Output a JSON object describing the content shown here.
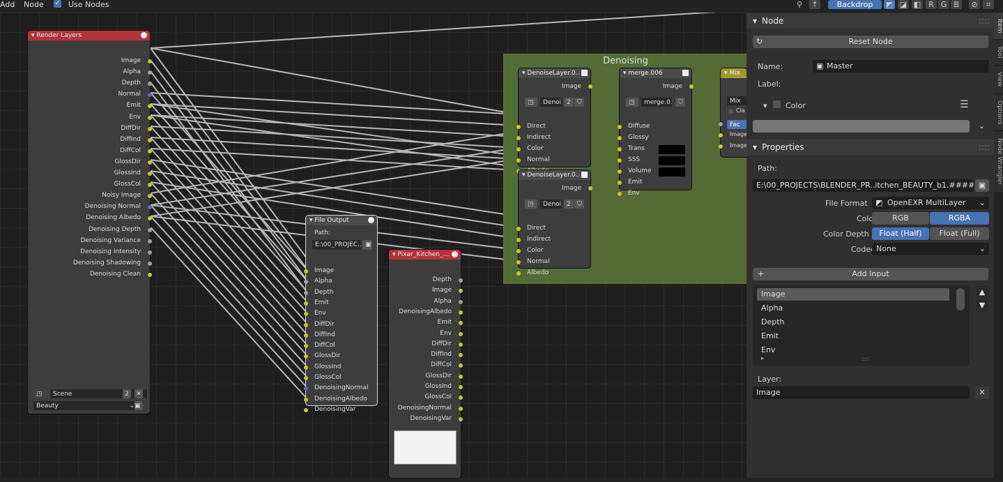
{
  "topbar": {
    "add": "Add",
    "node": "Node",
    "use_nodes": "Use Nodes",
    "backdrop": "Backdrop",
    "r": "R",
    "g": "G",
    "b": "B"
  },
  "render_layers": {
    "title": "Render Layers",
    "outputs": [
      "Image",
      "Alpha",
      "Depth",
      "Normal",
      "Emit",
      "Env",
      "DiffDir",
      "DiffInd",
      "DiffCol",
      "GlossDir",
      "GlossInd",
      "GlossCol",
      "Noisy Image",
      "Denoising Normal",
      "Denoising Albedo",
      "Denoising Depth",
      "Denoising Variance",
      "Denoising Intensity",
      "Denoising Shadowing",
      "Denoising Clean"
    ],
    "scene": "Scene",
    "scene_users": "2",
    "layer": "Beauty"
  },
  "file_output": {
    "title": "File Output",
    "path_label": "Path:",
    "path": "E:\\00_PROJEC...",
    "inputs": [
      "Image",
      "Alpha",
      "Depth",
      "Emit",
      "Env",
      "DiffDir",
      "DiffInd",
      "DiffCol",
      "GlossDir",
      "GlossInd",
      "GlossCol",
      "DenoisingNormal",
      "DenoisingAlbedo",
      "DenoisingVar"
    ]
  },
  "pixar_node": {
    "title": "Pixar_Kitchen_...",
    "outputs": [
      "Depth",
      "Image",
      "Alpha",
      "DenoisingAlbedo",
      "Emit",
      "Env",
      "DiffDir",
      "DiffInd",
      "DiffCol",
      "GlossDir",
      "GlossInd",
      "GlossCol",
      "DenoisingNormal",
      "DenoisingVar"
    ]
  },
  "frame": {
    "title": "Denoising"
  },
  "denoise1": {
    "title": "DenoiseLayer.0..",
    "output": "Image",
    "sel": "Denoi",
    "users": "2",
    "inputs": [
      "Direct",
      "Indirect",
      "Color",
      "Normal",
      "Albedo"
    ]
  },
  "denoise2": {
    "title": "DenoiseLayer.0..",
    "output": "Image",
    "sel": "Denoi",
    "users": "2",
    "inputs": [
      "Direct",
      "Indirect",
      "Color",
      "Normal",
      "Albedo"
    ]
  },
  "merge": {
    "title": "merge.006",
    "output": "Image",
    "sel": "merge.0..",
    "inputs": [
      "Diffuse",
      "Glossy",
      "Trans",
      "SSS",
      "Volume",
      "Emit",
      "Env"
    ]
  },
  "mix": {
    "title": "Mix",
    "mode": "Mix",
    "clamp": "Cla",
    "fac": "Fac",
    "in1": "Image",
    "in2": "Image"
  },
  "panel": {
    "node_header": "Node",
    "reset": "Reset Node",
    "name_label": "Name:",
    "name_value": "Master",
    "label_label": "Label:",
    "label_value": "",
    "color_label": "Color",
    "properties_header": "Properties",
    "path_label": "Path:",
    "path_value": "E:\\00_PROJECTS\\BLENDER_PR..itchen_BEAUTY_b1.####.exr",
    "file_format_label": "File Format",
    "file_format_value": "OpenEXR MultiLayer",
    "color_mode_label": "Color",
    "color_rgb": "RGB",
    "color_rgba": "RGBA",
    "depth_label": "Color Depth",
    "depth_half": "Float (Half)",
    "depth_full": "Float (Full)",
    "codec_label": "Codec",
    "codec_value": "None",
    "add_input": "Add Input",
    "list_items": [
      "Image",
      "Alpha",
      "Depth",
      "Emit",
      "Env"
    ],
    "layer_label": "Layer:",
    "layer_value": "Image"
  },
  "side_tabs": [
    "Item",
    "Tool",
    "View",
    "Options",
    "Node Wrangler"
  ]
}
